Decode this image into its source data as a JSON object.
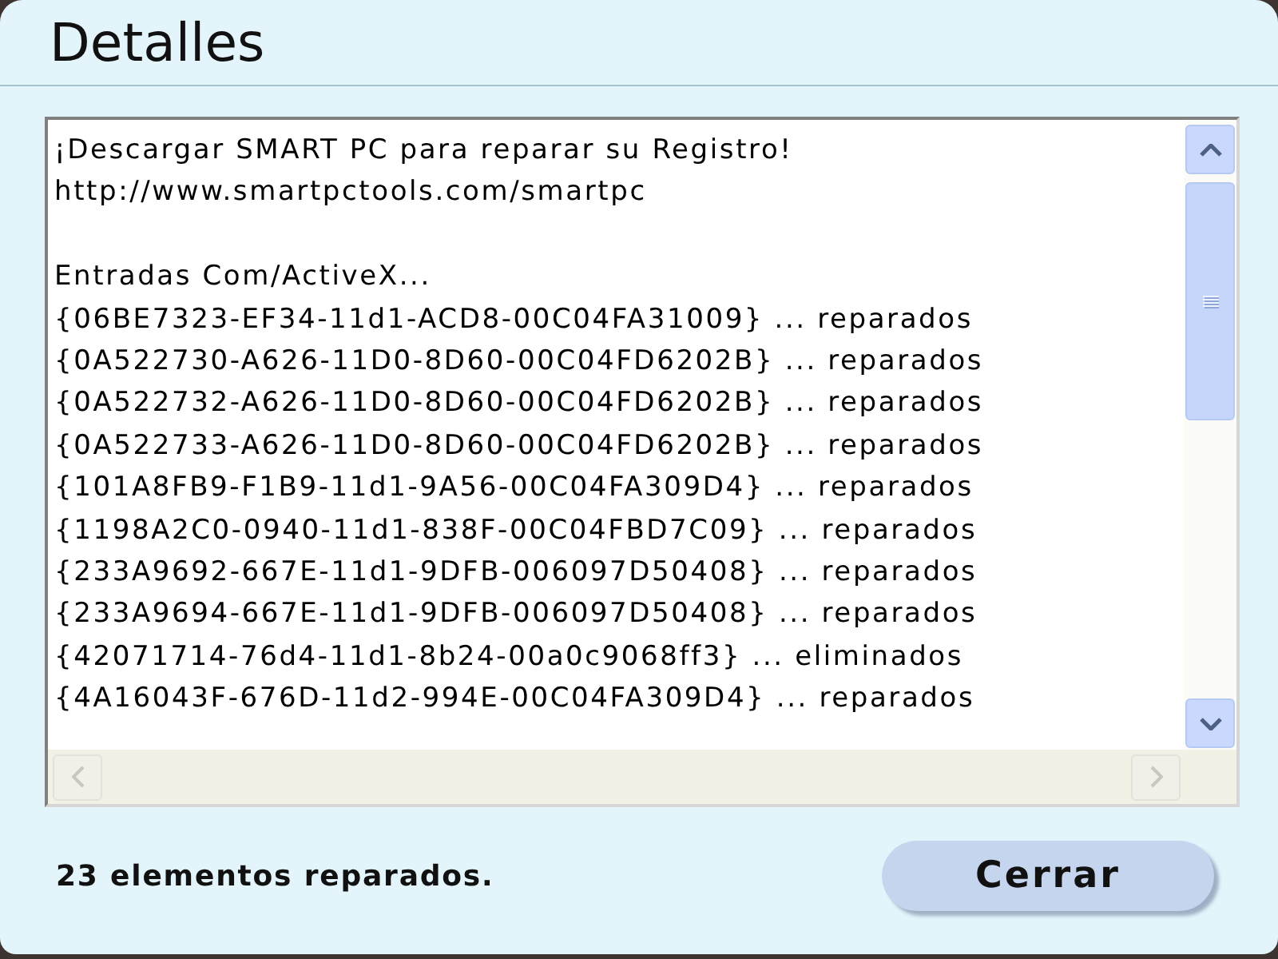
{
  "window": {
    "title": "Detalles"
  },
  "details_box": {
    "intro_lines": [
      "¡Descargar SMART PC para reparar su Registro!",
      "http://www.smartpctools.com/smartpc"
    ],
    "section": {
      "title": "Entradas Com/ActiveX...",
      "lines": [
        "{06BE7323-EF34-11d1-ACD8-00C04FA31009} ... reparados",
        "{0A522730-A626-11D0-8D60-00C04FD6202B} ... reparados",
        "{0A522732-A626-11D0-8D60-00C04FD6202B} ... reparados",
        "{0A522733-A626-11D0-8D60-00C04FD6202B} ... reparados",
        "{101A8FB9-F1B9-11d1-9A56-00C04FA309D4} ... reparados",
        "{1198A2C0-0940-11d1-838F-00C04FBD7C09} ... reparados",
        "{233A9692-667E-11d1-9DFB-006097D50408} ... reparados",
        "{233A9694-667E-11d1-9DFB-006097D50408} ... reparados",
        "{42071714-76d4-11d1-8b24-00a0c9068ff3} ... eliminados",
        "{4A16043F-676D-11d2-994E-00C04FA309D4} ... reparados"
      ]
    }
  },
  "status_text": "23 elementos reparados.",
  "buttons": [
    {
      "label": "Cerrar"
    }
  ]
}
